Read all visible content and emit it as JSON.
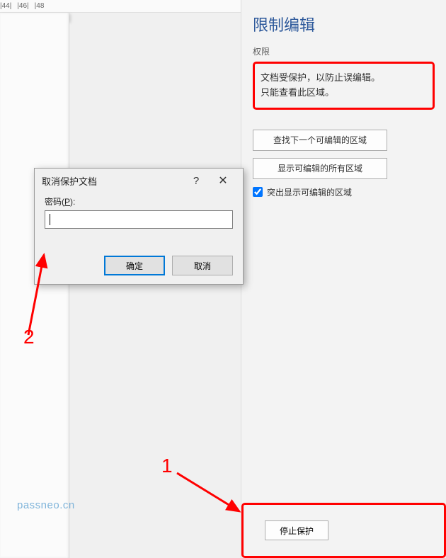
{
  "ruler": {
    "marks": [
      "|44|",
      "|46|",
      "|48"
    ]
  },
  "panel": {
    "title": "限制编辑",
    "subheader": "权限",
    "info_line1": "文档受保护，以防止误编辑。",
    "info_line2": "只能查看此区域。",
    "btn_find_next": "查找下一个可编辑的区域",
    "btn_show_all": "显示可编辑的所有区域",
    "chk_highlight": "突出显示可编辑的区域",
    "chk_highlight_checked": true,
    "btn_stop": "停止保护"
  },
  "dialog": {
    "title": "取消保护文档",
    "help_glyph": "?",
    "close_glyph": "✕",
    "label_prefix": "密码(",
    "label_mnemonic": "P",
    "label_suffix": "):",
    "value": "",
    "ok": "确定",
    "cancel": "取消"
  },
  "annotations": {
    "num1": "1",
    "num2": "2"
  },
  "watermark": "passneo.cn"
}
